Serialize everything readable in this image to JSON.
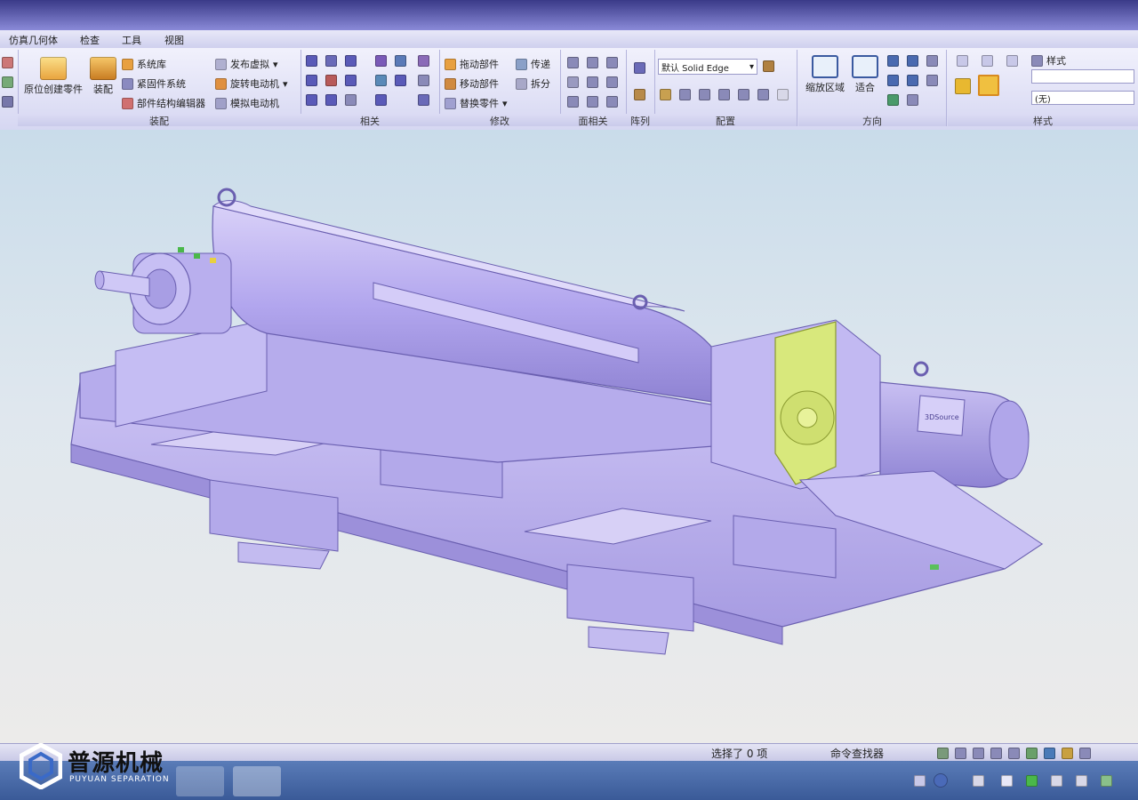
{
  "menu": {
    "tabs": [
      "仿真几何体",
      "检查",
      "工具",
      "视图"
    ]
  },
  "ribbon": {
    "assembly": {
      "label": "装配",
      "create_in_place": "原位创建零件",
      "assemble": "装配",
      "system_library": "系统库",
      "fastener_system": "紧固件系统",
      "structure_editor": "部件结构编辑器",
      "publish_virtual": "发布虚拟",
      "rotary_motor": "旋转电动机",
      "simulate_motor": "模拟电动机"
    },
    "relate": {
      "label": "相关"
    },
    "modify": {
      "label": "修改",
      "drag_part": "拖动部件",
      "move_part": "移动部件",
      "replace_part": "替换零件",
      "transfer": "传递",
      "disperse": "拆分"
    },
    "face_relate": {
      "label": "面相关"
    },
    "pattern": {
      "label": "阵列"
    },
    "config": {
      "label": "配置",
      "current": "默认 Solid Edge"
    },
    "orient": {
      "label": "方向",
      "zoom_area": "缩放区域",
      "fit": "适合"
    },
    "style": {
      "label": "样式",
      "style_label": "样式",
      "style_value": "(无)"
    }
  },
  "model": {
    "motor_label": "3DSource"
  },
  "statusbar": {
    "selection": "选择了 0 项",
    "command_finder": "命令查找器"
  },
  "watermark": {
    "brand_cn": "普源机械",
    "brand_en": "PUYUAN SEPARATION"
  },
  "colors": {
    "ribbon_bg": "#e6e6f8",
    "model_body": "#b4a8ec",
    "model_highlight": "#d8e87c",
    "viewport_top": "#c9dcea",
    "viewport_bottom": "#ecebea"
  }
}
